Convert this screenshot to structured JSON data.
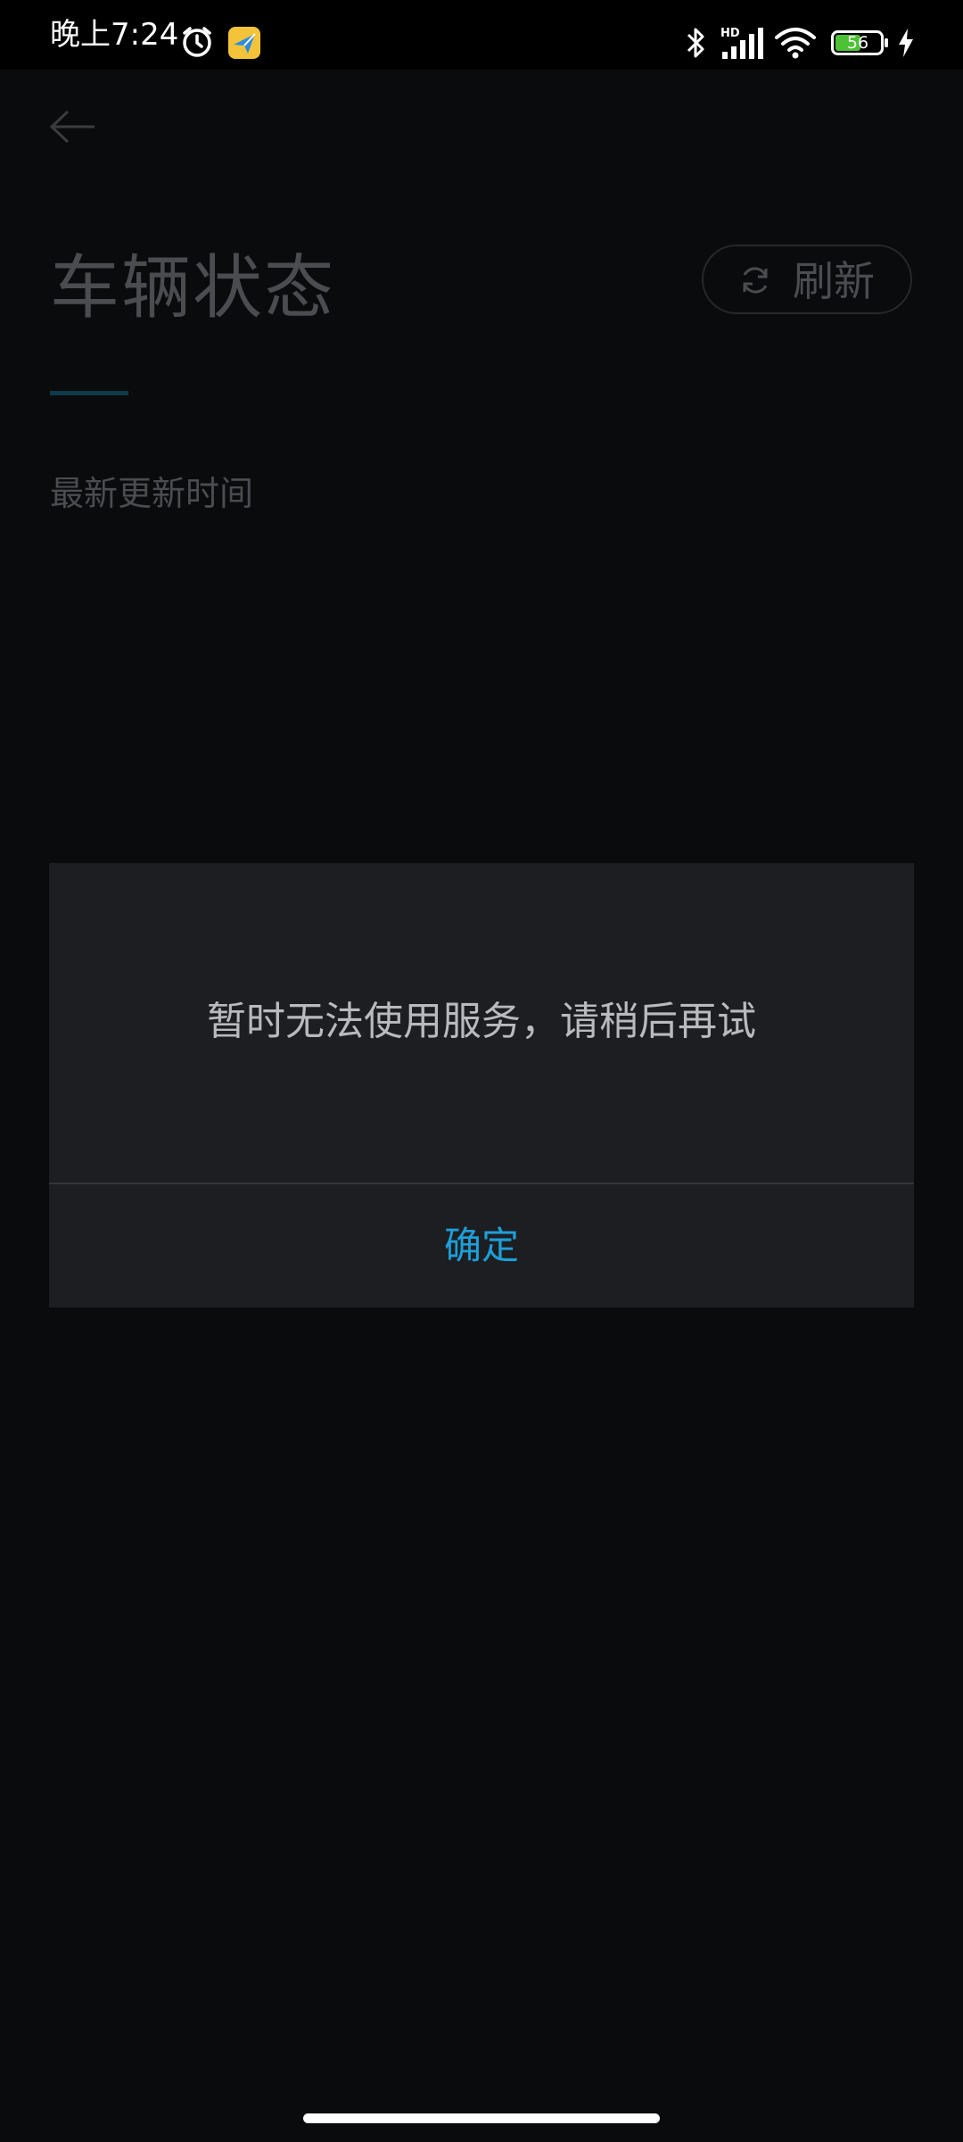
{
  "status_bar": {
    "time": "晚上7:24",
    "battery_level": "56",
    "network_badge": "HD",
    "icons_left": [
      "alarm-icon",
      "app-notification-icon"
    ],
    "icons_right": [
      "bluetooth-icon",
      "cellular-signal-icon",
      "wifi-icon",
      "battery-icon",
      "charging-icon"
    ]
  },
  "header": {
    "back_icon": "back-arrow-icon",
    "title": "车辆状态",
    "refresh_icon": "refresh-icon",
    "refresh_label": "刷新"
  },
  "content": {
    "update_time_label": "最新更新时间"
  },
  "dialog": {
    "message": "暂时无法使用服务，请稍后再试",
    "confirm_label": "确定"
  },
  "colors": {
    "background": "#0a0b0d",
    "dialog_background": "#1d1e22",
    "accent": "#1e9fd8",
    "dimmed_text": "#4a4c50",
    "dialog_text": "#b9babd"
  }
}
